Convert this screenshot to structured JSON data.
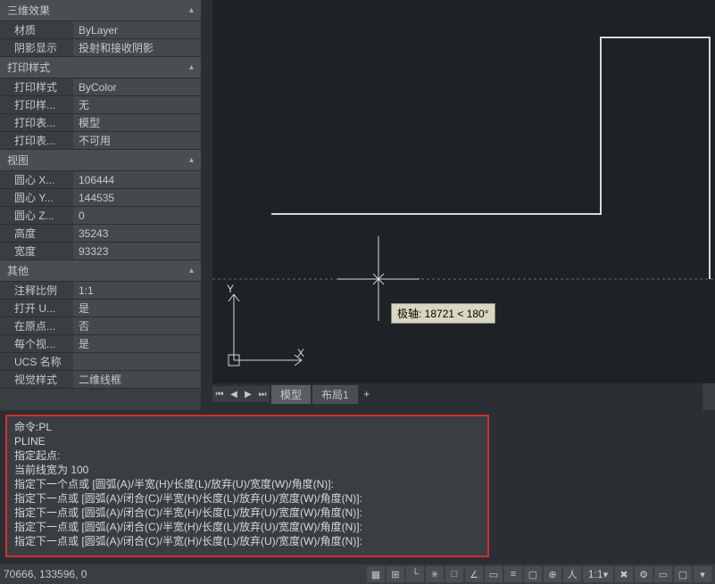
{
  "panel": {
    "sections": [
      {
        "title": "三维效果",
        "rows": [
          {
            "label": "材质",
            "value": "ByLayer"
          },
          {
            "label": "阴影显示",
            "value": "投射和接收阴影"
          }
        ]
      },
      {
        "title": "打印样式",
        "rows": [
          {
            "label": "打印样式",
            "value": "ByColor"
          },
          {
            "label": "打印样...",
            "value": "无"
          },
          {
            "label": "打印表...",
            "value": "模型"
          },
          {
            "label": "打印表...",
            "value": "不可用"
          }
        ]
      },
      {
        "title": "视图",
        "rows": [
          {
            "label": "圆心 X...",
            "value": "106444"
          },
          {
            "label": "圆心 Y...",
            "value": "144535"
          },
          {
            "label": "圆心 Z...",
            "value": "0"
          },
          {
            "label": "高度",
            "value": "35243"
          },
          {
            "label": "宽度",
            "value": "93323"
          }
        ]
      },
      {
        "title": "其他",
        "rows": [
          {
            "label": "注释比例",
            "value": "1:1"
          },
          {
            "label": "打开 U...",
            "value": "是"
          },
          {
            "label": "在原点...",
            "value": "否"
          },
          {
            "label": "每个视...",
            "value": "是"
          },
          {
            "label": "UCS 名称",
            "value": ""
          },
          {
            "label": "视觉样式",
            "value": "二维线框"
          }
        ]
      }
    ]
  },
  "tabs": {
    "model": "模型",
    "layout": "布局1"
  },
  "tooltip": "极轴: 18721 < 180°",
  "cmd": {
    "l0": "命令:PL",
    "l1": "PLINE",
    "l2": "指定起点:",
    "l3": "当前线宽为 100",
    "l4": "指定下一个点或 [圆弧(A)/半宽(H)/长度(L)/放弃(U)/宽度(W)/角度(N)]:",
    "l5": "指定下一点或 [圆弧(A)/闭合(C)/半宽(H)/长度(L)/放弃(U)/宽度(W)/角度(N)]:",
    "l6": "指定下一点或 [圆弧(A)/闭合(C)/半宽(H)/长度(L)/放弃(U)/宽度(W)/角度(N)]:",
    "l7": "指定下一点或 [圆弧(A)/闭合(C)/半宽(H)/长度(L)/放弃(U)/宽度(W)/角度(N)]:",
    "l8": "指定下一点或 [圆弧(A)/闭合(C)/半宽(H)/长度(L)/放弃(U)/宽度(W)/角度(N)]:"
  },
  "status": {
    "coords": "70666, 133596, 0",
    "scale": "1:1"
  },
  "ucs": {
    "y": "Y",
    "x": "X"
  }
}
